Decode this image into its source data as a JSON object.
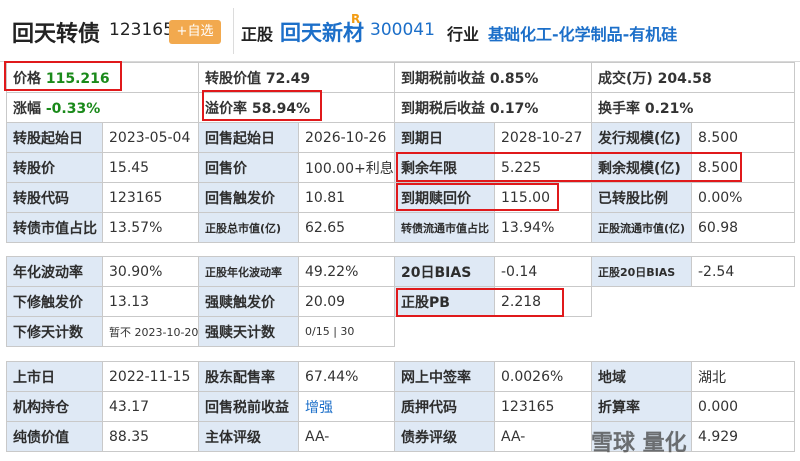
{
  "header": {
    "bond_name": "回天转债",
    "bond_code": "123165",
    "fav_label": "+自选",
    "stock_tag": "正股",
    "stock_name": "回天新材",
    "stock_sup": "R",
    "stock_code": "300041",
    "industry_tag": "行业",
    "industry_value": "基础化工-化学制品-有机硅"
  },
  "quote": {
    "price_label": "价格",
    "price_value": "115.216",
    "conv_value_label": "转股价值",
    "conv_value": "72.49",
    "ytm_pre_label": "到期税前收益",
    "ytm_pre": "0.85%",
    "volume_label": "成交(万)",
    "volume": "204.58",
    "chg_label": "涨幅",
    "chg_value": "-0.33%",
    "premium_label": "溢价率",
    "premium_value": "58.94%",
    "ytm_post_label": "到期税后收益",
    "ytm_post": "0.17%",
    "turnover_label": "换手率",
    "turnover": "0.21%"
  },
  "table1": [
    [
      "转股起始日",
      "2023-05-04",
      "回售起始日",
      "2026-10-26",
      "到期日",
      "2028-10-27",
      "发行规模(亿)",
      "8.500"
    ],
    [
      "转股价",
      "15.45",
      "回售价",
      "100.00+利息",
      "剩余年限",
      "5.225",
      "剩余规模(亿)",
      "8.500"
    ],
    [
      "转股代码",
      "123165",
      "回售触发价",
      "10.81",
      "到期赎回价",
      "115.00",
      "已转股比例",
      "0.00%"
    ],
    [
      "转债市值占比",
      "13.57%",
      "正股总市值(亿)",
      "62.65",
      "转债流通市值占比",
      "13.94%",
      "正股流通市值(亿)",
      "60.98"
    ]
  ],
  "table2": [
    [
      "年化波动率",
      "30.90%",
      "正股年化波动率",
      "49.22%",
      "20日BIAS",
      "-0.14",
      "正股20日BIAS",
      "-2.54"
    ],
    [
      "下修触发价",
      "13.13",
      "强赎触发价",
      "20.09",
      "正股PB",
      "2.218"
    ],
    [
      "下修天计数",
      "暂不 2023-10-20 重新计",
      "强赎天计数",
      "0/15 | 30"
    ]
  ],
  "table3": [
    [
      "上市日",
      "2022-11-15",
      "股东配售率",
      "67.44%",
      "网上中签率",
      "0.0026%",
      "地域",
      "湖北"
    ],
    [
      "机构持仓",
      "43.17",
      "回售税前收益",
      "增强",
      "质押代码",
      "123165",
      "折算率",
      "0.000"
    ],
    [
      "纯债价值",
      "88.35",
      "主体评级",
      "AA-",
      "债券评级",
      "AA-",
      "",
      "4.929"
    ]
  ],
  "watermark_overlay": "雪球 量化"
}
